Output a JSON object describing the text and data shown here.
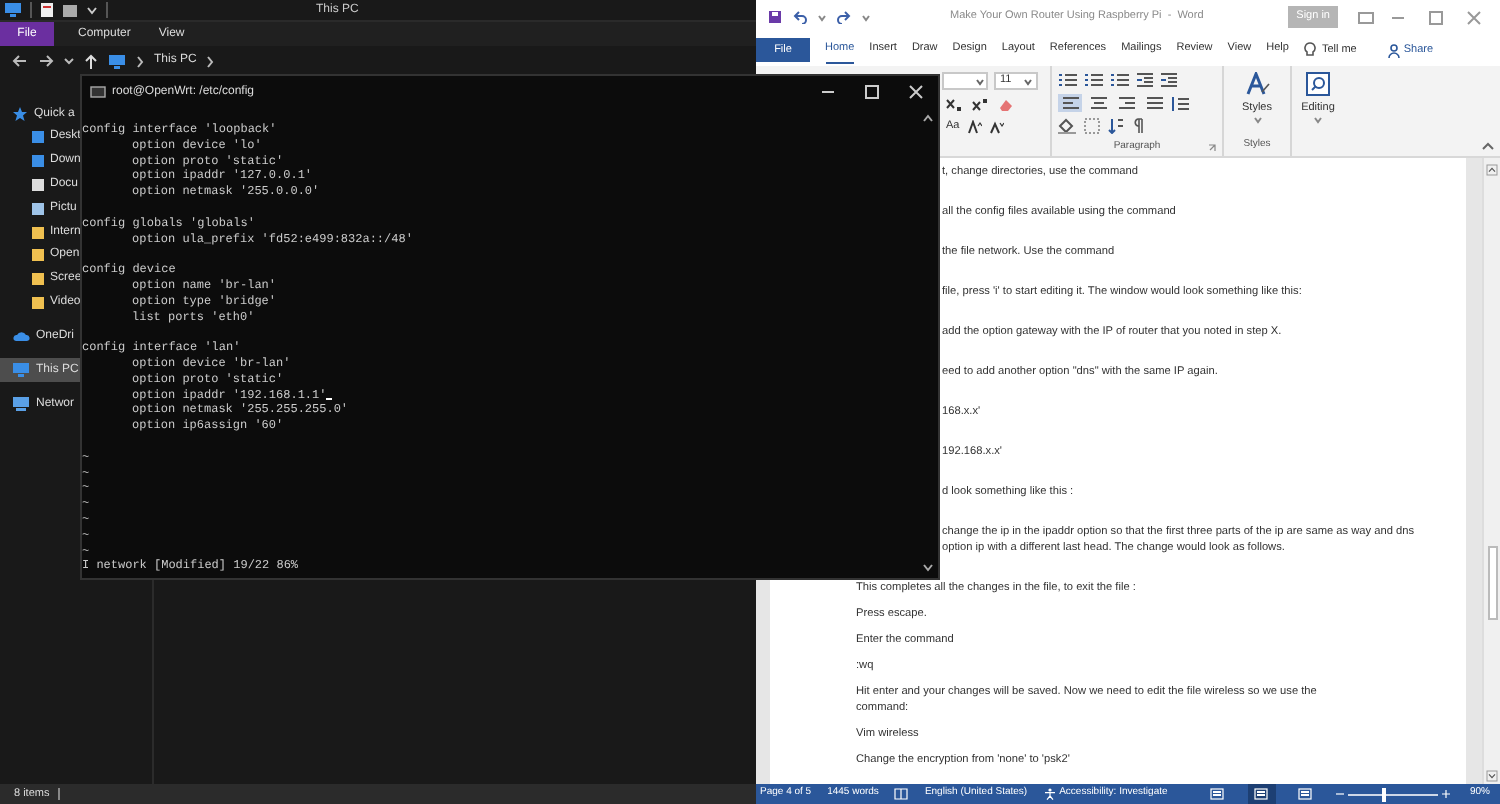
{
  "explorer": {
    "title": "This PC",
    "file_tab": "File",
    "tabs": [
      "Computer",
      "View"
    ],
    "path": "This PC",
    "nav": [
      {
        "label": "Quick a",
        "selected": false,
        "children": [
          {
            "label": "Deskt",
            "selected": false
          },
          {
            "label": "Down",
            "selected": false
          },
          {
            "label": "Docu",
            "selected": false
          },
          {
            "label": "Pictu",
            "selected": false
          },
          {
            "label": "Intern",
            "selected": false
          },
          {
            "label": "Open",
            "selected": false
          },
          {
            "label": "Scree",
            "selected": false
          },
          {
            "label": "Video",
            "selected": false
          }
        ]
      },
      {
        "label": "OneDri",
        "selected": false
      },
      {
        "label": "This PC",
        "selected": true
      },
      {
        "label": "Networ",
        "selected": false
      }
    ],
    "status": "8 items"
  },
  "terminal": {
    "title": "root@OpenWrt: /etc/config",
    "blocks": [
      {
        "header": "config interface 'loopback'",
        "options": [
          {
            "text": "option device 'lo'",
            "cursor": false
          },
          {
            "text": "option proto 'static'",
            "cursor": false
          },
          {
            "text": "option ipaddr '127.0.0.1'",
            "cursor": false
          },
          {
            "text": "option netmask '255.0.0.0'",
            "cursor": false
          }
        ]
      },
      {
        "header": "config globals 'globals'",
        "options": [
          {
            "text": "option ula_prefix 'fd52:e499:832a::/48'",
            "cursor": false
          }
        ]
      },
      {
        "header": "config device",
        "options": [
          {
            "text": "option name 'br-lan'",
            "cursor": false
          },
          {
            "text": "option type 'bridge'",
            "cursor": false
          },
          {
            "text": "list ports 'eth0'",
            "cursor": false
          }
        ]
      },
      {
        "header": "config interface 'lan'",
        "options": [
          {
            "text": "option device 'br-lan'",
            "cursor": false
          },
          {
            "text": "option proto 'static'",
            "cursor": false
          },
          {
            "text": "option ipaddr '192.168.1.1'",
            "cursor": true
          },
          {
            "text": "option netmask '255.255.255.0'",
            "cursor": false
          },
          {
            "text": "option ip6assign '60'",
            "cursor": false
          }
        ]
      }
    ],
    "empty_markers": [
      "~",
      "~",
      "~",
      "~",
      "~",
      "~",
      "~"
    ],
    "status_line": "I network [Modified] 19/22 86%"
  },
  "word": {
    "title": "Make Your Own Router Using Raspberry Pi  -  Word",
    "sign_in": "Sign in",
    "file_tab": "File",
    "tabs": [
      {
        "label": "Home",
        "selected": true
      },
      {
        "label": "Insert",
        "selected": false
      },
      {
        "label": "Draw",
        "selected": false
      },
      {
        "label": "Design",
        "selected": false
      },
      {
        "label": "Layout",
        "selected": false
      },
      {
        "label": "References",
        "selected": false
      },
      {
        "label": "Mailings",
        "selected": false
      },
      {
        "label": "Review",
        "selected": false
      },
      {
        "label": "View",
        "selected": false
      },
      {
        "label": "Help",
        "selected": false
      }
    ],
    "tell_me": "Tell me",
    "share": "Share",
    "ribbon": {
      "font_size": "11",
      "change_case": "Aa",
      "align_buttons": [
        {
          "selected": true
        },
        {
          "selected": false
        },
        {
          "selected": false
        },
        {
          "selected": false
        }
      ],
      "paragraph_label": "Paragraph",
      "styles_button": "Styles",
      "styles_label": "Styles",
      "editing_button": "Editing"
    },
    "paragraphs": [
      {
        "kind": "cut",
        "text": "t, change directories, use the command"
      },
      {
        "kind": "cut",
        "text": "all the config files available using the command"
      },
      {
        "kind": "cut",
        "text": "the file network. Use the command"
      },
      {
        "kind": "cut",
        "text": "file, press 'i' to start editing it. The window would look something like this:"
      },
      {
        "kind": "cut",
        "text": "add the option gateway with the IP of router that you noted in step X."
      },
      {
        "kind": "cut",
        "text": "eed to add another option \"dns\" with the same IP again."
      },
      {
        "kind": "cut",
        "text": "168.x.x'"
      },
      {
        "kind": "cut",
        "text": "192.168.x.x'"
      },
      {
        "kind": "cut",
        "text": "d look something like this :"
      },
      {
        "kind": "cut",
        "text": "change the ip in the ipaddr option so that the first three parts of the ip are same as way and dns option ip with a different last head. The change would look as follows."
      },
      {
        "kind": "full",
        "text": "This completes all the changes in the file, to exit the file :"
      },
      {
        "kind": "full",
        "text": "Press escape."
      },
      {
        "kind": "full",
        "text": "Enter the command"
      },
      {
        "kind": "full",
        "text": ":wq"
      },
      {
        "kind": "full",
        "text": "Hit enter and your changes will be saved. Now we need to edit the file wireless so we use the command:"
      },
      {
        "kind": "full",
        "text": "Vim wireless"
      },
      {
        "kind": "full",
        "text": "Change the encryption from 'none' to 'psk2'"
      }
    ],
    "status": {
      "page": "Page 4 of 5",
      "words": "1445 words",
      "language": "English (United States)",
      "accessibility": "Accessibility: Investigate",
      "view_buttons": [
        {
          "selected": false
        },
        {
          "selected": true
        },
        {
          "selected": false
        }
      ],
      "zoom": {
        "level": 0.4
      },
      "zoom_text": "90%"
    }
  }
}
